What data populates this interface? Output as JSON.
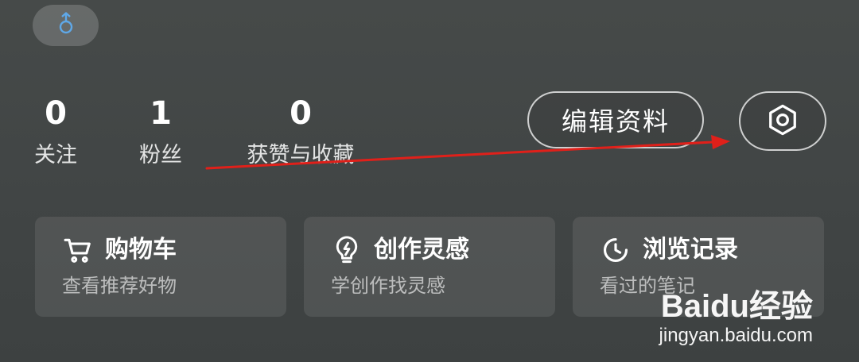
{
  "profile": {
    "gender_icon": "male-symbol-icon",
    "stats": [
      {
        "value": "0",
        "label": "关注"
      },
      {
        "value": "1",
        "label": "粉丝"
      },
      {
        "value": "0",
        "label": "获赞与收藏"
      }
    ],
    "edit_label": "编辑资料",
    "settings_icon": "gear-icon"
  },
  "cards": [
    {
      "icon": "cart-icon",
      "title": "购物车",
      "subtitle": "查看推荐好物"
    },
    {
      "icon": "lightbulb-icon",
      "title": "创作灵感",
      "subtitle": "学创作找灵感"
    },
    {
      "icon": "clock-icon",
      "title": "浏览记录",
      "subtitle": "看过的笔记"
    }
  ],
  "annotation": {
    "arrow_color": "#e0201a"
  },
  "watermark": {
    "logo_text": "Baidu经验",
    "url": "jingyan.baidu.com"
  }
}
